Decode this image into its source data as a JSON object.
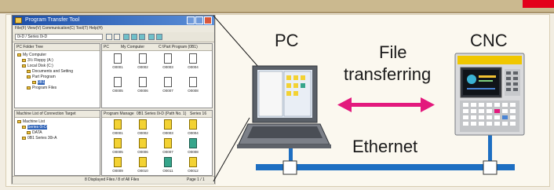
{
  "screenshot": {
    "title": "Program Transfer Tool",
    "menu": "File(F)   View(V)   Communication(C)   Tool(T)   Help(H)",
    "cnc_select": "0i-D / Series 0i-D",
    "pc_pane_header": "PC Folder Tree",
    "pc_path_cols": [
      "PC",
      "My Computer",
      "C:\\Part Program (0B1)"
    ],
    "pc_tree": [
      "My Computer",
      "3½ Floppy (A:)",
      "Local Disk (C:)",
      "Documents and Setting",
      "Part Program",
      "0B1",
      "Program Files"
    ],
    "pc_files": [
      "O0001",
      "O0002",
      "O0003",
      "O0004",
      "O0005",
      "O0006",
      "O0007",
      "O0008"
    ],
    "cnc_pane_header": "Machine List of Connection Target",
    "cnc_path_cols": [
      "Program Manage",
      "0B1  Series 0i-D (Path No. 1)",
      "Series 16"
    ],
    "cnc_tree": [
      "Machine List",
      "Series 0i-D",
      "DATA",
      "0B1 Series 30i-A"
    ],
    "cnc_files": [
      "O0001",
      "O0002",
      "O0003",
      "O0004",
      "O0005",
      "O0006",
      "O0007",
      "O0008",
      "O0009",
      "O0010",
      "O0011",
      "O0012"
    ],
    "status_left": "8 Displayed Files / 8 of All Files",
    "status_right": "Page 1 / 1"
  },
  "diagram": {
    "pc_label": "PC",
    "cnc_label": "CNC",
    "transfer_label_line1": "File",
    "transfer_label_line2": "transferring",
    "network_label": "Ethernet"
  },
  "colors": {
    "accent_red": "#e3001b",
    "arrow_magenta": "#e3197d",
    "ethernet_blue": "#1e6fc2",
    "background": "#fbf8ef",
    "header_band": "#cbb98f"
  }
}
